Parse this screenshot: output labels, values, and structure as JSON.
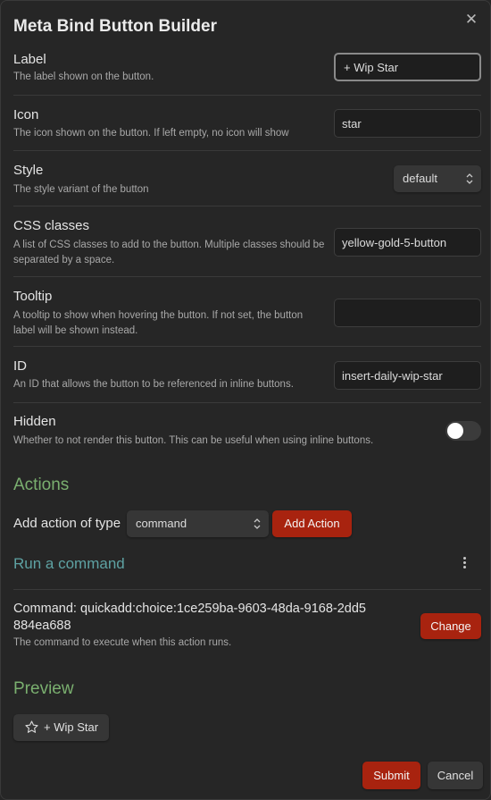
{
  "modal": {
    "title": "Meta Bind Button Builder",
    "close_icon": "close-icon"
  },
  "settings": {
    "label": {
      "name": "Label",
      "desc": "The label shown on the button.",
      "value": "+ Wip Star"
    },
    "icon": {
      "name": "Icon",
      "desc": "The icon shown on the button. If left empty, no icon will show",
      "value": "star"
    },
    "style": {
      "name": "Style",
      "desc": "The style variant of the button",
      "value": "default"
    },
    "css_classes": {
      "name": "CSS classes",
      "desc": "A list of CSS classes to add to the button. Multiple classes should be separated by a space.",
      "value": "yellow-gold-5-button"
    },
    "tooltip": {
      "name": "Tooltip",
      "desc": "A tooltip to show when hovering the button. If not set, the button label will be shown instead.",
      "value": ""
    },
    "id": {
      "name": "ID",
      "desc": "An ID that allows the button to be referenced in inline buttons.",
      "value": "insert-daily-wip-star"
    },
    "hidden": {
      "name": "Hidden",
      "desc": "Whether to not render this button. This can be useful when using inline buttons.",
      "enabled": false
    }
  },
  "actions": {
    "heading": "Actions",
    "add_label": "Add action of type",
    "type_value": "command",
    "add_button": "Add Action",
    "run_command_heading": "Run a command",
    "menu_icon": "more-vertical-icon",
    "command_name": "Command: quickadd:choice:1ce259ba-9603-48da-9168-2dd5884ea688",
    "command_desc": "The command to execute when this action runs.",
    "change_button": "Change"
  },
  "preview": {
    "heading": "Preview",
    "button_label": "+ Wip Star",
    "button_icon": "star-icon"
  },
  "footer": {
    "submit": "Submit",
    "cancel": "Cancel"
  },
  "colors": {
    "accent": "#a8230f",
    "heading_green": "#7aaf6f",
    "heading_teal": "#5ea2a3",
    "background": "#262626"
  }
}
